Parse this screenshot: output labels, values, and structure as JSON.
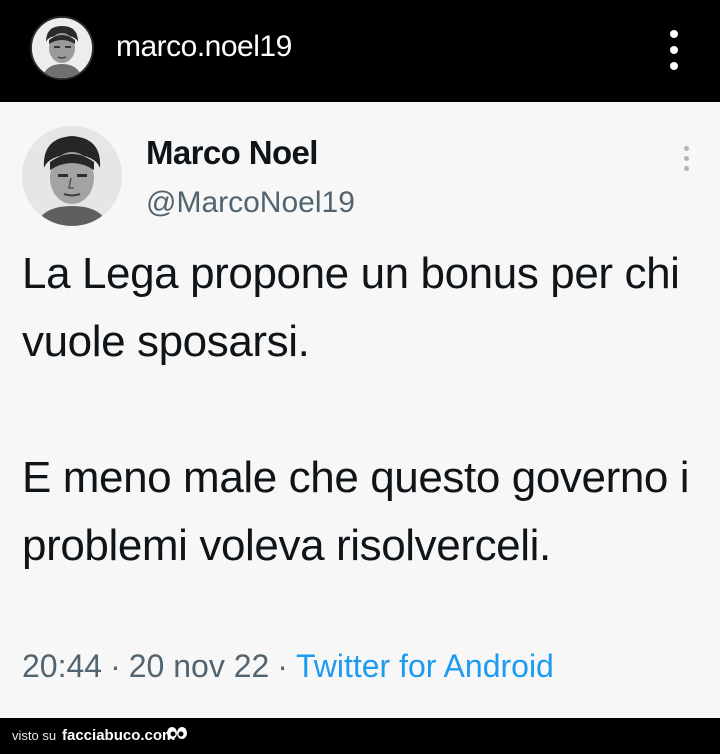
{
  "header": {
    "username": "marco.noel19",
    "avatar_icon": "profile-photo",
    "menu_icon": "more-vertical-icon"
  },
  "tweet": {
    "display_name": "Marco Noel",
    "handle": "@MarcoNoel19",
    "paragraphs": [
      "La Lega propone un bonus per chi vuole sposarsi.",
      "E meno male che questo governo i problemi voleva risolverceli."
    ],
    "time": "20:44",
    "date": "20 nov 22",
    "separator": "·",
    "source": "Twitter for Android",
    "source_color": "#1d9bf0",
    "text_color": "#0f1419",
    "meta_color": "#536471",
    "menu_icon": "more-vertical-icon"
  },
  "footer": {
    "seen_on": "visto su",
    "site": "facciabuco.com",
    "logo_icon": "eyes-logo"
  }
}
